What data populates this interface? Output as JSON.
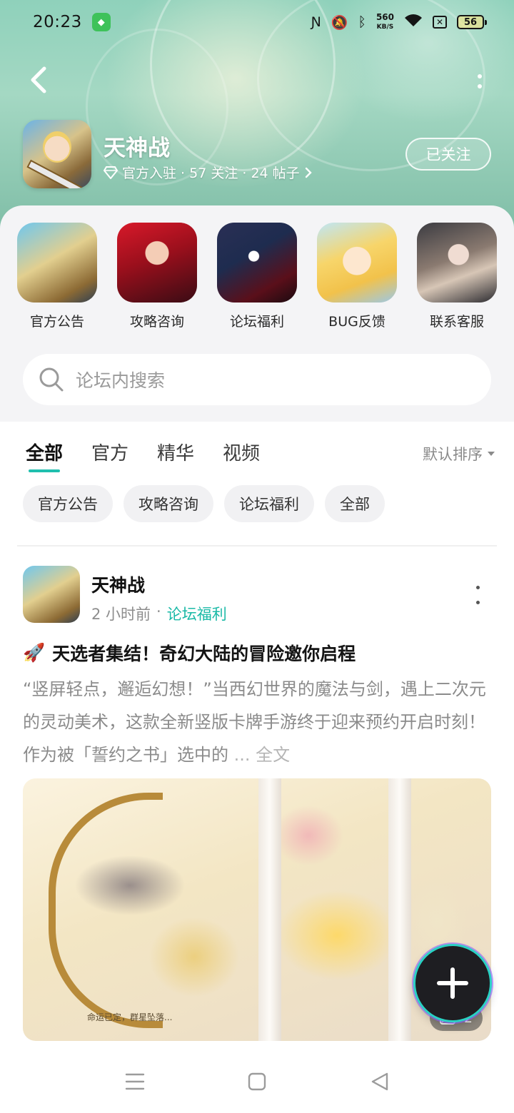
{
  "status_bar": {
    "time": "20:23",
    "net_speed_value": "560",
    "net_speed_unit": "KB/S",
    "battery": "56",
    "icons": [
      "app-notification-icon",
      "nfc-icon",
      "mute-icon",
      "bluetooth-icon",
      "wifi-icon",
      "sim-icon",
      "battery-icon"
    ]
  },
  "header": {
    "forum_name": "天神战",
    "meta": "官方入驻 · 57 关注 · 24 帖子",
    "follow_label": "已关注",
    "icons": [
      "back-icon",
      "more-icon",
      "verified-diamond-icon",
      "chevron-right-icon"
    ]
  },
  "categories": [
    {
      "label": "官方公告"
    },
    {
      "label": "攻略咨询"
    },
    {
      "label": "论坛福利"
    },
    {
      "label": "BUG反馈"
    },
    {
      "label": "联系客服"
    }
  ],
  "search": {
    "placeholder": "论坛内搜索"
  },
  "tabs": [
    {
      "label": "全部",
      "active": true
    },
    {
      "label": "官方",
      "active": false
    },
    {
      "label": "精华",
      "active": false
    },
    {
      "label": "视频",
      "active": false
    }
  ],
  "sort": {
    "label": "默认排序"
  },
  "chips": [
    {
      "label": "官方公告"
    },
    {
      "label": "攻略咨询"
    },
    {
      "label": "论坛福利"
    },
    {
      "label": "全部"
    }
  ],
  "post": {
    "author": "天神战",
    "time": "2 小时前",
    "separator": "·",
    "board": "论坛福利",
    "title_emoji": "🚀",
    "title": "天选者集结！奇幻大陆的冒险邀你启程",
    "body": "“竖屏轻点，邂逅幻想！”当西幻世界的魔法与剑，遇上二次元的灵动美术，这款全新竖版卡牌手游终于迎来预约开启时刻！作为被「誓约之书」选中的",
    "more_label": "... 全文",
    "image_caption": "命运已定，群星坠落...",
    "image_count": "2"
  },
  "colors": {
    "accent": "#1fbfae",
    "banner": "#8fd1bb",
    "fab": "#1e1e22"
  },
  "navbar": {
    "icons": [
      "menu-icon",
      "home-square-icon",
      "back-triangle-icon"
    ]
  }
}
